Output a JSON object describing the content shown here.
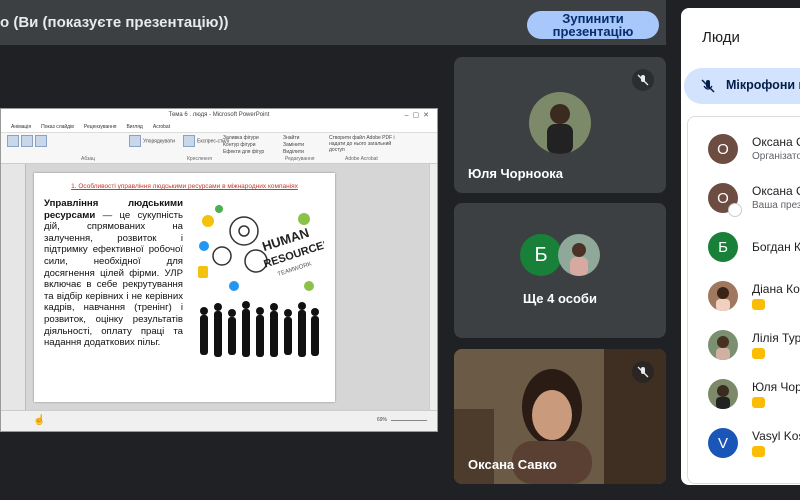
{
  "topbar": {
    "title": "о (Ви (показуєте презентацію))",
    "stop_button": "Зупинити презентацію"
  },
  "ppt": {
    "window_title": "Тема 6 . людя - Microsoft PowerPoint",
    "menu": [
      "Анімація",
      "Показ слайдів",
      "Рецензування",
      "Вигляд",
      "Acrobat"
    ],
    "ribbon_groups": [
      "Абзац",
      "Креслення",
      "Редагування",
      "Adobe Acrobat"
    ],
    "ribbon_items": {
      "arrange": "Упорядкувати",
      "quick_styles": "Експрес-стилі",
      "shape_fill": "Заливка фігури",
      "shape_outline": "Контур фігури",
      "shape_effects": "Ефекти для фігур",
      "find": "Знайти",
      "replace": "Замінити",
      "select": "Виділити",
      "create_pdf": "Створити файл Adobe PDF і надати до нього загальний доступ"
    },
    "slide": {
      "heading": "1. Особливості управління людськими ресурсами в міжнародних компаніях",
      "bold_term": "Управління людськими ресурсами",
      "body": " — це сукупність дій, спрямованих на залучення, розвиток і підтримку ефективної робочої сили, необхідної для досягнення цілей фірми. УЛР включає в себе рекрутування та відбір керівних і не керівних кадрів, навчання (тренінг) і розвиток, оцінку результатів діяльності, оплату праці та надання додаткових пільг.",
      "image_text_1": "HUMAN",
      "image_text_2": "RESOURCES",
      "image_text_3": "TEAMWORK"
    },
    "zoom": "69%"
  },
  "tiles": {
    "t1_name": "Юля Чорноока",
    "t2_more": "Ще 4 особи",
    "t2_letter": "Б",
    "t3_name": "Оксана Савко"
  },
  "people": {
    "title": "Люди",
    "chip_label": "Мікрофони вс",
    "rows": [
      {
        "letter": "О",
        "name": "Оксана С",
        "sub": "Організато"
      },
      {
        "letter": "О",
        "name": "Оксана С",
        "sub": "Ваша през"
      },
      {
        "letter": "Б",
        "name": "Богдан К"
      },
      {
        "letter": "",
        "name": "Діана Кор"
      },
      {
        "letter": "",
        "name": "Лілія Тур"
      },
      {
        "letter": "",
        "name": "Юля Чор"
      },
      {
        "letter": "V",
        "name": "Vasyl Kos"
      }
    ]
  },
  "colors": {
    "accent_chip": "#d3e3fd",
    "stop_button": "#a8c7fa",
    "avatar_brown": "#6d4c41",
    "avatar_green": "#188038",
    "avatar_blue": "#1a56b8",
    "hand_badge": "#fbbc04"
  }
}
